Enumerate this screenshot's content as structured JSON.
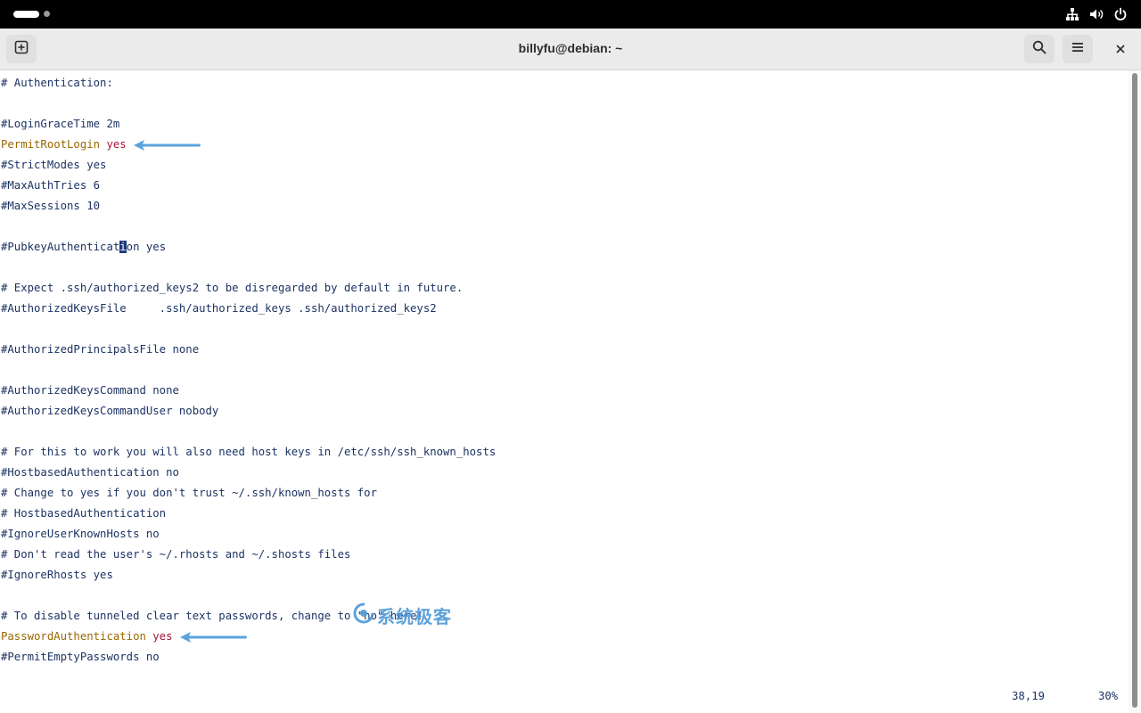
{
  "window": {
    "title": "billyfu@debian: ~"
  },
  "topbar": {
    "tray_icons": [
      "network-icon",
      "volume-icon",
      "power-icon"
    ]
  },
  "headerbar": {
    "new_tab_icon": "new-tab-icon",
    "search_icon": "search-icon",
    "menu_icon": "hamburger-menu-icon",
    "close_icon": "close-icon"
  },
  "terminal": {
    "lines": [
      {
        "text": "# Authentication:"
      },
      {
        "text": ""
      },
      {
        "text": "#LoginGraceTime 2m"
      },
      {
        "keyword": "PermitRootLogin",
        "value": "yes",
        "arrow": true
      },
      {
        "text": "#StrictModes yes"
      },
      {
        "text": "#MaxAuthTries 6"
      },
      {
        "text": "#MaxSessions 10"
      },
      {
        "text": ""
      },
      {
        "before_cursor": "#PubkeyAuthenticat",
        "cursor_char": "i",
        "after_cursor": "on yes"
      },
      {
        "text": ""
      },
      {
        "text": "# Expect .ssh/authorized_keys2 to be disregarded by default in future."
      },
      {
        "text": "#AuthorizedKeysFile     .ssh/authorized_keys .ssh/authorized_keys2"
      },
      {
        "text": ""
      },
      {
        "text": "#AuthorizedPrincipalsFile none"
      },
      {
        "text": ""
      },
      {
        "text": "#AuthorizedKeysCommand none"
      },
      {
        "text": "#AuthorizedKeysCommandUser nobody"
      },
      {
        "text": ""
      },
      {
        "text": "# For this to work you will also need host keys in /etc/ssh/ssh_known_hosts"
      },
      {
        "text": "#HostbasedAuthentication no"
      },
      {
        "text": "# Change to yes if you don't trust ~/.ssh/known_hosts for"
      },
      {
        "text": "# HostbasedAuthentication"
      },
      {
        "text": "#IgnoreUserKnownHosts no"
      },
      {
        "text": "# Don't read the user's ~/.rhosts and ~/.shosts files"
      },
      {
        "text": "#IgnoreRhosts yes"
      },
      {
        "text": ""
      },
      {
        "text": "# To disable tunneled clear text passwords, change to \"no\" here!"
      },
      {
        "keyword": "PasswordAuthentication",
        "value": "yes",
        "arrow": true
      },
      {
        "text": "#PermitEmptyPasswords no"
      }
    ],
    "cursor_position": "38,19",
    "scroll_percent": "30%"
  },
  "watermark": {
    "text": "系统极客"
  },
  "colors": {
    "comment": "#1c3363",
    "keyword": "#9a6700",
    "value": "#a5153a",
    "arrow": "#5ba3dc"
  }
}
